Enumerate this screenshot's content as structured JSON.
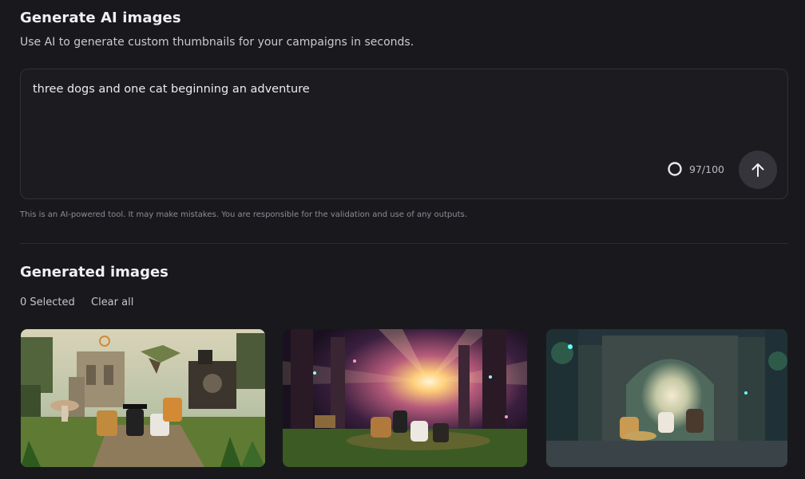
{
  "header": {
    "title": "Generate AI images",
    "subtitle": "Use AI to generate custom thumbnails for your campaigns in seconds."
  },
  "prompt": {
    "value": "three dogs and one cat beginning an adventure",
    "counter": "97/100",
    "submit_icon": "arrow-up-icon"
  },
  "disclaimer": "This is an AI-powered tool. It may make mistakes. You are responsible for the validation and use of any outputs.",
  "generated": {
    "title": "Generated images",
    "selected_label": "0 Selected",
    "clear_all_label": "Clear all",
    "images": [
      {
        "scene": "voxel-style animals in front of ruins and steampunk machine"
      },
      {
        "scene": "animals in glowing forest with bright sunburst"
      },
      {
        "scene": "animals under stone archway in overgrown temple"
      }
    ]
  },
  "colors": {
    "background": "#19191d",
    "panel_border": "#303036",
    "submit_button": "#34343a"
  }
}
